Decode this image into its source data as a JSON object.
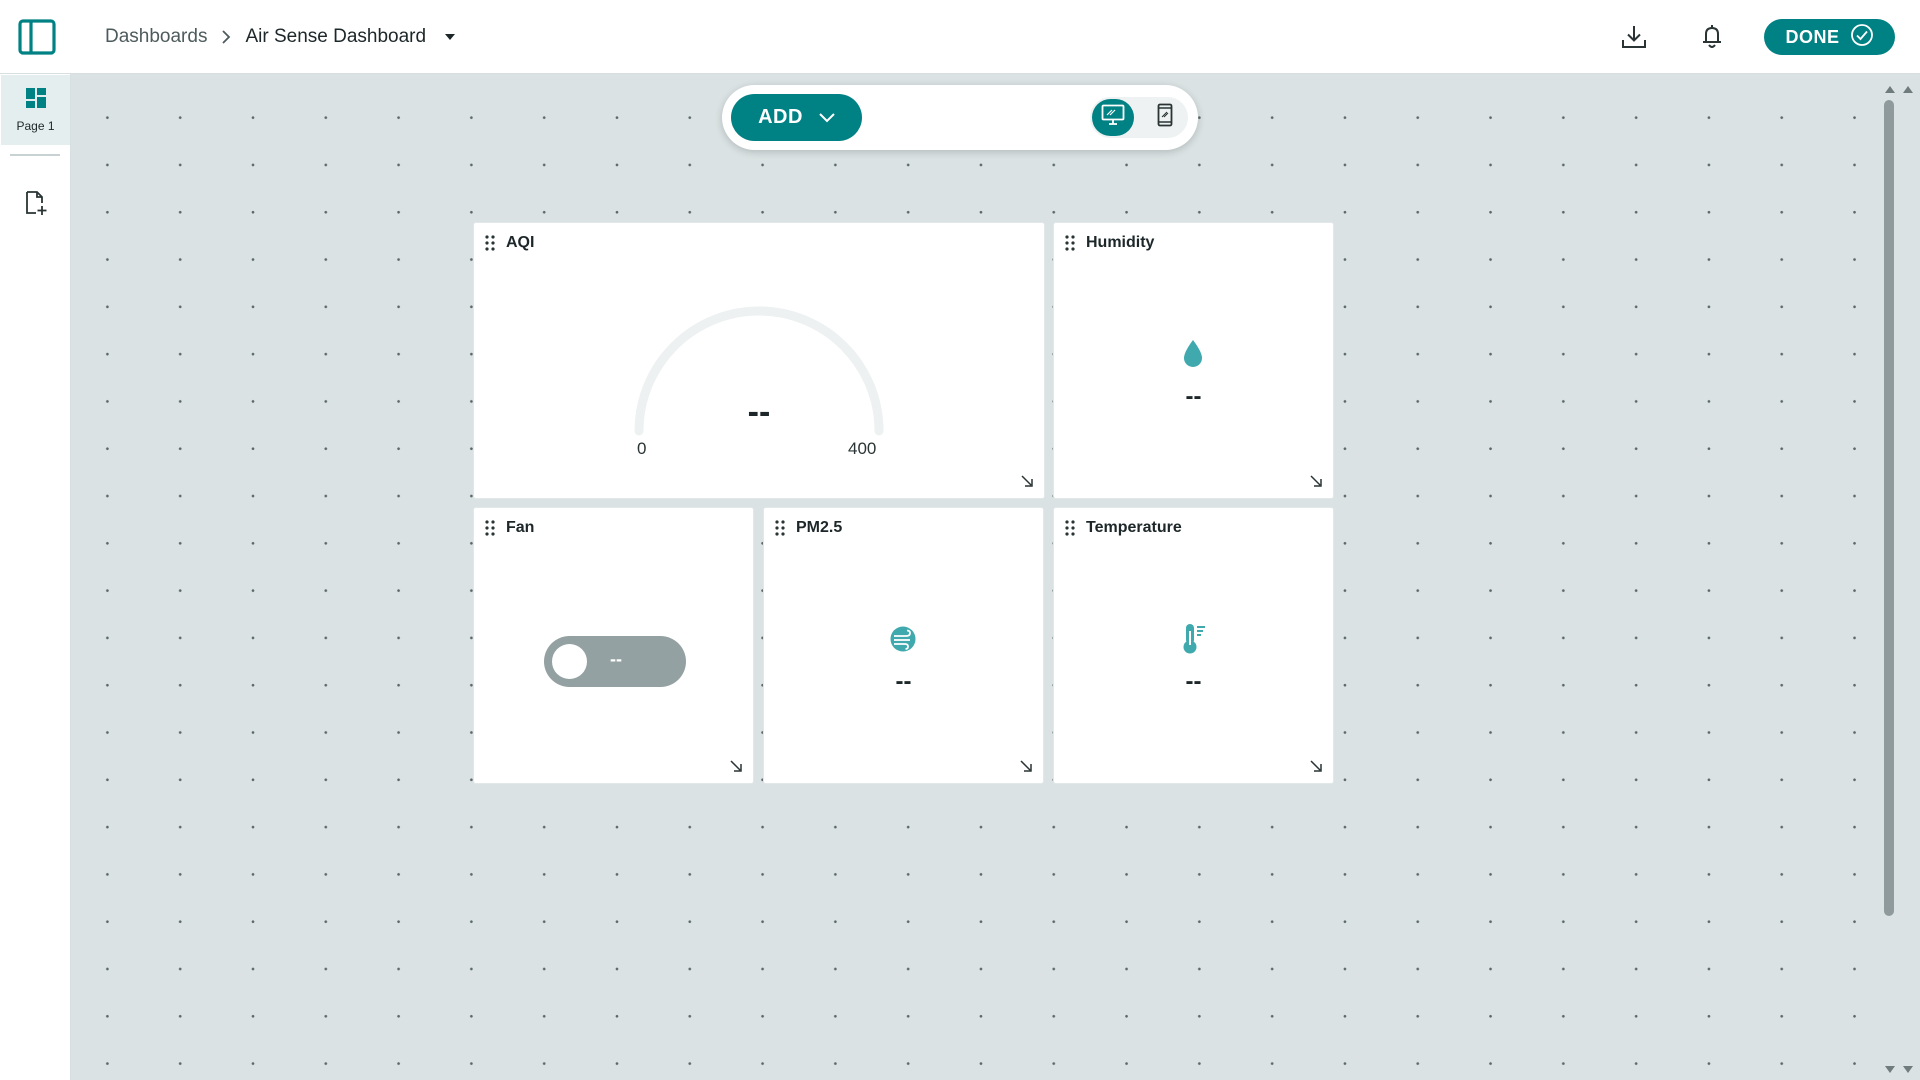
{
  "header": {
    "breadcrumb_parent": "Dashboards",
    "breadcrumb_current": "Air Sense Dashboard",
    "done_label": "DONE",
    "icons": [
      "sidebar-toggle-icon",
      "download-icon",
      "bell-icon",
      "check-circle-icon"
    ]
  },
  "sidebar": {
    "pages": [
      {
        "label": "Page 1",
        "icon": "dashboard-grid-icon"
      }
    ],
    "add_page_icon": "add-page-icon"
  },
  "toolbar": {
    "add_label": "ADD",
    "views": [
      "desktop",
      "mobile"
    ],
    "active_view": "desktop"
  },
  "widgets": {
    "aqi": {
      "title": "AQI",
      "value": "--",
      "min": "0",
      "max": "400",
      "type": "gauge"
    },
    "humidity": {
      "title": "Humidity",
      "value": "--",
      "icon": "water-drop-icon"
    },
    "fan": {
      "title": "Fan",
      "value": "--",
      "type": "switch"
    },
    "pm25": {
      "title": "PM2.5",
      "value": "--",
      "icon": "air-wind-icon"
    },
    "temperature": {
      "title": "Temperature",
      "value": "--",
      "icon": "thermometer-icon"
    }
  },
  "colors": {
    "accent": "#008184",
    "canvas": "#dae2e3",
    "icon_teal": "#3fa9ad",
    "switch_off": "#94a1a2"
  }
}
